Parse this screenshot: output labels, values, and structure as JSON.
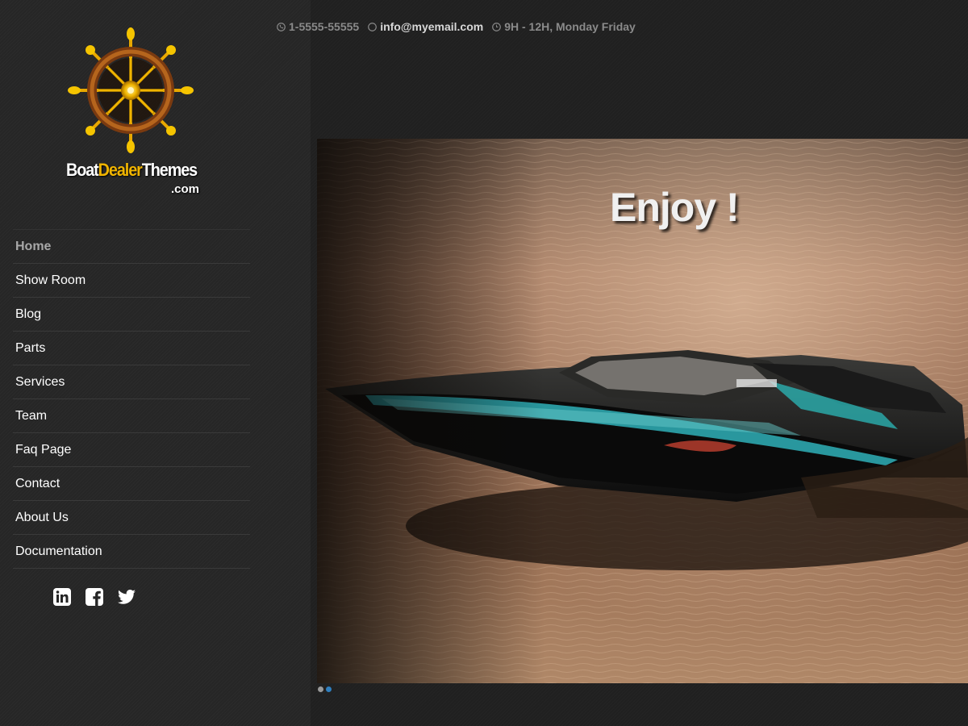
{
  "topbar": {
    "phone": "1-5555-55555",
    "email": "info@myemail.com",
    "hours": "9H - 12H, Monday Friday"
  },
  "logo": {
    "part1": "Boat",
    "part2": "Dealer",
    "part3": "Themes",
    "suffix": ".com"
  },
  "nav": {
    "items": [
      {
        "label": "Home",
        "active": true
      },
      {
        "label": "Show Room"
      },
      {
        "label": "Blog"
      },
      {
        "label": "Parts"
      },
      {
        "label": "Services"
      },
      {
        "label": "Team"
      },
      {
        "label": "Faq Page"
      },
      {
        "label": "Contact"
      },
      {
        "label": "About Us"
      },
      {
        "label": "Documentation"
      }
    ]
  },
  "social": [
    "linkedin-icon",
    "facebook-icon",
    "twitter-icon"
  ],
  "slider": {
    "caption": "Enjoy !",
    "slides": 2,
    "active_slide": 2
  },
  "colors": {
    "background": "#202020",
    "sidebar": "#262626",
    "logo_accent": "#f0b400",
    "active_dot": "#2f7fbf",
    "nav_active": "#a8a8a8"
  }
}
